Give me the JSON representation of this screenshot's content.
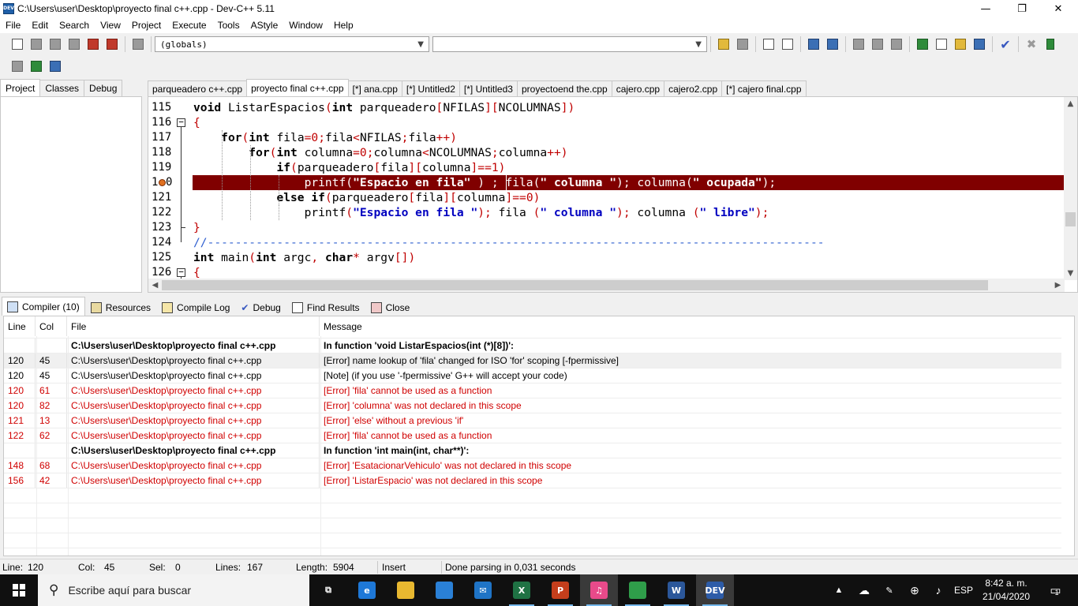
{
  "window": {
    "title": "C:\\Users\\user\\Desktop\\proyecto final c++.cpp - Dev-C++ 5.11",
    "app_icon_text": "DEV",
    "minimize": "—",
    "maximize": "❐",
    "close": "✕"
  },
  "menu": [
    "File",
    "Edit",
    "Search",
    "View",
    "Project",
    "Execute",
    "Tools",
    "AStyle",
    "Window",
    "Help"
  ],
  "toolbar": {
    "scope_select": "(globals)",
    "symbol_select": ""
  },
  "left_tabs": [
    "Project",
    "Classes",
    "Debug"
  ],
  "editor_tabs": [
    "parqueadero c++.cpp",
    "proyecto final c++.cpp",
    "[*] ana.cpp",
    "[*] Untitled2",
    "[*] Untitled3",
    "proyectoend the.cpp",
    "cajero.cpp",
    "cajero2.cpp",
    "[*] cajero final.cpp"
  ],
  "active_editor_tab": 1,
  "code": {
    "line_numbers": [
      "115",
      "116",
      "117",
      "118",
      "119",
      "1",
      "121",
      "122",
      "123",
      "124",
      "125",
      "126"
    ],
    "error_line_suffix": "0",
    "lines": [
      [
        [
          "kw",
          "void"
        ],
        [
          "id",
          " ListarEspacios"
        ],
        [
          "op",
          "("
        ],
        [
          "kw",
          "int"
        ],
        [
          "id",
          " parqueadero"
        ],
        [
          "op",
          "["
        ],
        [
          "id",
          "NFILAS"
        ],
        [
          "op",
          "]["
        ],
        [
          "id",
          "NCOLUMNAS"
        ],
        [
          "op",
          "])"
        ]
      ],
      [
        [
          "op",
          "{"
        ]
      ],
      [
        [
          "id",
          "    "
        ],
        [
          "kw",
          "for"
        ],
        [
          "op",
          "("
        ],
        [
          "kw",
          "int"
        ],
        [
          "id",
          " fila"
        ],
        [
          "op",
          "="
        ],
        [
          "num",
          "0"
        ],
        [
          "op",
          ";"
        ],
        [
          "id",
          "fila"
        ],
        [
          "op",
          "<"
        ],
        [
          "id",
          "NFILAS"
        ],
        [
          "op",
          ";"
        ],
        [
          "id",
          "fila"
        ],
        [
          "op",
          "++)"
        ]
      ],
      [
        [
          "id",
          "        "
        ],
        [
          "kw",
          "for"
        ],
        [
          "op",
          "("
        ],
        [
          "kw",
          "int"
        ],
        [
          "id",
          " columna"
        ],
        [
          "op",
          "="
        ],
        [
          "num",
          "0"
        ],
        [
          "op",
          ";"
        ],
        [
          "id",
          "columna"
        ],
        [
          "op",
          "<"
        ],
        [
          "id",
          "NCOLUMNAS"
        ],
        [
          "op",
          ";"
        ],
        [
          "id",
          "columna"
        ],
        [
          "op",
          "++)"
        ]
      ],
      [
        [
          "id",
          "            "
        ],
        [
          "kw",
          "if"
        ],
        [
          "op",
          "("
        ],
        [
          "id",
          "parqueadero"
        ],
        [
          "op",
          "["
        ],
        [
          "id",
          "fila"
        ],
        [
          "op",
          "]["
        ],
        [
          "id",
          "columna"
        ],
        [
          "op",
          "]=="
        ],
        [
          "num",
          "1"
        ],
        [
          "op",
          ")"
        ]
      ],
      [
        [
          "id",
          "                printf"
        ],
        [
          "op",
          "("
        ],
        [
          "str-b",
          "\"Espacio en fila\""
        ],
        [
          "id",
          " "
        ],
        [
          "op",
          ")"
        ],
        [
          "id",
          " "
        ],
        [
          "op",
          ";"
        ],
        [
          "id",
          " fila"
        ],
        [
          "op",
          "("
        ],
        [
          "str-b",
          "\" columna \""
        ],
        [
          "op",
          ")"
        ],
        [
          "op",
          ";"
        ],
        [
          "id",
          " columna"
        ],
        [
          "op",
          "("
        ],
        [
          "str-b",
          "\" ocupada\""
        ],
        [
          "op",
          ")"
        ],
        [
          "op",
          ";"
        ]
      ],
      [
        [
          "id",
          "            "
        ],
        [
          "kw",
          "else"
        ],
        [
          "id",
          " "
        ],
        [
          "kw",
          "if"
        ],
        [
          "op",
          "("
        ],
        [
          "id",
          "parqueadero"
        ],
        [
          "op",
          "["
        ],
        [
          "id",
          "fila"
        ],
        [
          "op",
          "]["
        ],
        [
          "id",
          "columna"
        ],
        [
          "op",
          "]=="
        ],
        [
          "num",
          "0"
        ],
        [
          "op",
          ")"
        ]
      ],
      [
        [
          "id",
          "                printf"
        ],
        [
          "op",
          "("
        ],
        [
          "str-b",
          "\"Espacio en fila \""
        ],
        [
          "op",
          ")"
        ],
        [
          "op",
          ";"
        ],
        [
          "id",
          " fila "
        ],
        [
          "op",
          "("
        ],
        [
          "str-b",
          "\" columna \""
        ],
        [
          "op",
          ")"
        ],
        [
          "op",
          ";"
        ],
        [
          "id",
          " columna "
        ],
        [
          "op",
          "("
        ],
        [
          "str-b",
          "\" libre\""
        ],
        [
          "op",
          ")"
        ],
        [
          "op",
          ";"
        ]
      ],
      [
        [
          "op",
          "}"
        ]
      ],
      [
        [
          "cmt",
          "//-----------------------------------------------------------------------------------------"
        ]
      ],
      [
        [
          "kw",
          "int"
        ],
        [
          "id",
          " main"
        ],
        [
          "op",
          "("
        ],
        [
          "kw",
          "int"
        ],
        [
          "id",
          " argc"
        ],
        [
          "op",
          ","
        ],
        [
          "id",
          " "
        ],
        [
          "kw",
          "char"
        ],
        [
          "op",
          "*"
        ],
        [
          "id",
          " argv"
        ],
        [
          "op",
          "[])"
        ]
      ],
      [
        [
          "op",
          "{"
        ]
      ]
    ]
  },
  "bottom_tabs": [
    "Compiler (10)",
    "Resources",
    "Compile Log",
    "Debug",
    "Find Results",
    "Close"
  ],
  "messages": {
    "headers": [
      "Line",
      "Col",
      "File",
      "Message"
    ],
    "rows": [
      {
        "line": "",
        "col": "",
        "file": "C:\\Users\\user\\Desktop\\proyecto final c++.cpp",
        "message": "In function 'void ListarEspacios(int (*)[8])':",
        "style": "bold"
      },
      {
        "line": "120",
        "col": "45",
        "file": "C:\\Users\\user\\Desktop\\proyecto final c++.cpp",
        "message": "[Error] name lookup of 'fila' changed for ISO 'for' scoping [-fpermissive]",
        "style": "sel"
      },
      {
        "line": "120",
        "col": "45",
        "file": "C:\\Users\\user\\Desktop\\proyecto final c++.cpp",
        "message": "[Note] (if you use '-fpermissive' G++ will accept your code)",
        "style": "normal"
      },
      {
        "line": "120",
        "col": "61",
        "file": "C:\\Users\\user\\Desktop\\proyecto final c++.cpp",
        "message": "[Error] 'fila' cannot be used as a function",
        "style": "red"
      },
      {
        "line": "120",
        "col": "82",
        "file": "C:\\Users\\user\\Desktop\\proyecto final c++.cpp",
        "message": "[Error] 'columna' was not declared in this scope",
        "style": "red"
      },
      {
        "line": "121",
        "col": "13",
        "file": "C:\\Users\\user\\Desktop\\proyecto final c++.cpp",
        "message": "[Error] 'else' without a previous 'if'",
        "style": "red"
      },
      {
        "line": "122",
        "col": "62",
        "file": "C:\\Users\\user\\Desktop\\proyecto final c++.cpp",
        "message": "[Error] 'fila' cannot be used as a function",
        "style": "red"
      },
      {
        "line": "",
        "col": "",
        "file": "C:\\Users\\user\\Desktop\\proyecto final c++.cpp",
        "message": "In function 'int main(int, char**)':",
        "style": "bold"
      },
      {
        "line": "148",
        "col": "68",
        "file": "C:\\Users\\user\\Desktop\\proyecto final c++.cpp",
        "message": "[Error] 'EsatacionarVehiculo' was not declared in this scope",
        "style": "red"
      },
      {
        "line": "156",
        "col": "42",
        "file": "C:\\Users\\user\\Desktop\\proyecto final c++.cpp",
        "message": "[Error] 'ListarEspacio' was not declared in this scope",
        "style": "red"
      }
    ]
  },
  "status": {
    "line_label": "Line:",
    "line_value": "120",
    "col_label": "Col:",
    "col_value": "45",
    "sel_label": "Sel:",
    "sel_value": "0",
    "lines_label": "Lines:",
    "lines_value": "167",
    "length_label": "Length:",
    "length_value": "5904",
    "mode": "Insert",
    "message": "Done parsing in 0,031 seconds"
  },
  "taskbar": {
    "search_placeholder": "Escribe aquí para buscar",
    "language": "ESP",
    "time": "8:42 a. m.",
    "date": "21/04/2020",
    "notification_count": "1",
    "apps": [
      {
        "name": "task-view-icon",
        "label": "⧉",
        "color": "#101010"
      },
      {
        "name": "edge-icon",
        "label": "e",
        "color": "#1e78d7"
      },
      {
        "name": "file-explorer-icon",
        "label": "",
        "color": "#e8b830"
      },
      {
        "name": "store-icon",
        "label": "",
        "color": "#2a80d6"
      },
      {
        "name": "mail-icon",
        "label": "✉",
        "color": "#1f74c6"
      },
      {
        "name": "excel-icon",
        "label": "X",
        "color": "#1f7244"
      },
      {
        "name": "powerpoint-icon",
        "label": "P",
        "color": "#c43e1c"
      },
      {
        "name": "itunes-icon",
        "label": "♫",
        "color": "#e84a8a"
      },
      {
        "name": "chrome-icon",
        "label": "",
        "color": "#2f9d4a"
      },
      {
        "name": "word-icon",
        "label": "W",
        "color": "#2b579a"
      },
      {
        "name": "devcpp-icon",
        "label": "DEV",
        "color": "#2d5ca8"
      }
    ]
  }
}
